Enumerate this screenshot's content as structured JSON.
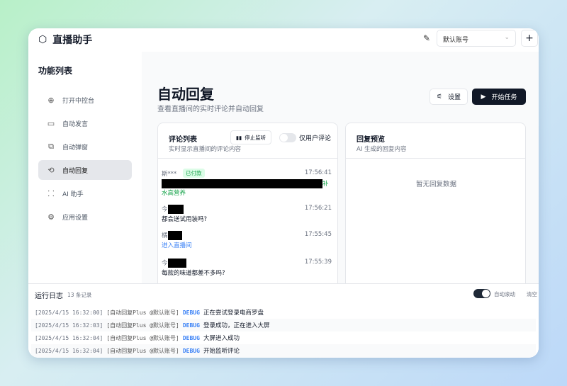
{
  "app": {
    "title": "直播助手",
    "account": "默认账号"
  },
  "sidebar": {
    "heading": "功能列表",
    "items": [
      {
        "label": "打开中控台",
        "icon": "globe-icon"
      },
      {
        "label": "自动发言",
        "icon": "message-icon"
      },
      {
        "label": "自动弹窗",
        "icon": "package-icon"
      },
      {
        "label": "自动回复",
        "icon": "reply-icon",
        "active": true
      },
      {
        "label": "AI 助手",
        "icon": "ai-icon"
      },
      {
        "label": "应用设置",
        "icon": "gear-icon"
      }
    ]
  },
  "page": {
    "title": "自动回复",
    "subtitle": "查看直播间的实时评论并自动回复",
    "settings_label": "设置",
    "start_label": "开始任务"
  },
  "comments": {
    "title": "评论列表",
    "subtitle": "实时显示直播间的评论内容",
    "stop_label": "停止监听",
    "filter_label": "仅用户评论",
    "filter_on": false,
    "items": [
      {
        "user": "斯***",
        "badge": "已付款",
        "time": "17:56:41",
        "text_tail": "补",
        "text2": "水高营养",
        "color": "#16a34a"
      },
      {
        "user": "今",
        "time": "17:56:21",
        "text": "都会送试用装吗?",
        "color": "#111827"
      },
      {
        "user": "橘",
        "time": "17:55:45",
        "text": "进入直播间",
        "color": "#3b82f6"
      },
      {
        "user": "今",
        "time": "17:55:39",
        "text": "每款的味道都差不多吗?",
        "color": "#111827"
      }
    ]
  },
  "preview": {
    "title": "回复预览",
    "subtitle": "AI 生成的回复内容",
    "empty": "暂无回复数据"
  },
  "log": {
    "title": "运行日志",
    "count": "13 条记录",
    "autoscroll_label": "自动滚动",
    "autoscroll_on": true,
    "clear_label": "清空",
    "rows": [
      {
        "ts": "[2025/4/15 16:32:00]",
        "src": "[自动回复Plus @默认账号]",
        "level": "DEBUG",
        "msg": "正在尝试登录电商罗盘"
      },
      {
        "ts": "[2025/4/15 16:32:03]",
        "src": "[自动回复Plus @默认账号]",
        "level": "DEBUG",
        "msg": "登录成功，正在进入大屏"
      },
      {
        "ts": "[2025/4/15 16:32:04]",
        "src": "[自动回复Plus @默认账号]",
        "level": "DEBUG",
        "msg": "大屏进入成功"
      },
      {
        "ts": "[2025/4/15 16:32:04]",
        "src": "[自动回复Plus @默认账号]",
        "level": "DEBUG",
        "msg": "开始监听评论"
      }
    ]
  }
}
